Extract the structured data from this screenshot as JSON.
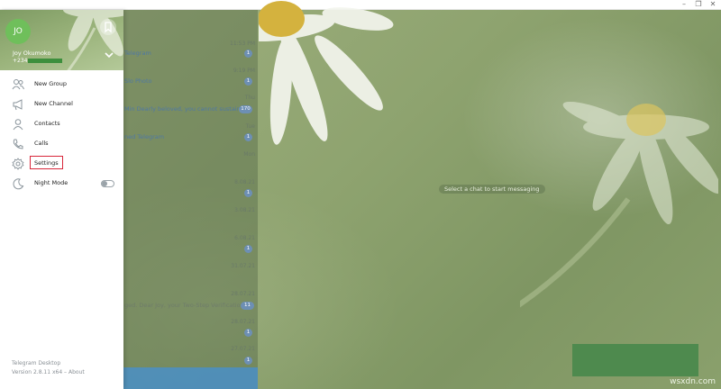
{
  "window": {
    "controls": [
      "–",
      "❐",
      "✕"
    ]
  },
  "main": {
    "empty_state": "Select a chat to start messaging"
  },
  "watermark": "wsxdn.com",
  "account": {
    "avatar_initials": "JO",
    "name": "Joy Okumoko",
    "phone_prefix": "+234"
  },
  "menu": {
    "items": [
      {
        "label": "New Group",
        "icon": "new-group-icon"
      },
      {
        "label": "New Channel",
        "icon": "megaphone-icon"
      },
      {
        "label": "Contacts",
        "icon": "contact-icon"
      },
      {
        "label": "Calls",
        "icon": "phone-icon"
      },
      {
        "label": "Settings",
        "icon": "gear-icon"
      },
      {
        "label": "Night Mode",
        "icon": "moon-icon",
        "toggle": false
      }
    ],
    "footer": {
      "app_name": "Telegram Desktop",
      "version": "Version 2.8.11 x64 – About"
    }
  },
  "chats": [
    {
      "time": "11:53 PM",
      "text": "Telegram",
      "badge": "1"
    },
    {
      "time": "9:19 PM",
      "text": "Slo Photo",
      "badge": "1"
    },
    {
      "time": "Thu",
      "text": "Min Dearly beloved, you cannot sustain...",
      "badge": "170"
    },
    {
      "time": "Tue",
      "text": "ned Telegram",
      "badge": "1"
    },
    {
      "time": "Mon",
      "text": "",
      "badge": ""
    },
    {
      "time": "8.08.21",
      "text": "",
      "badge": "1"
    },
    {
      "time": "3.08.21",
      "text": "",
      "badge": ""
    },
    {
      "time": "6.08.21",
      "text": "",
      "badge": "1"
    },
    {
      "time": "31.07.21",
      "text": "",
      "badge": ""
    },
    {
      "time": "28.07.21",
      "text": "ged. Dear Joy, your Two-Step Verification...",
      "badge": "11"
    },
    {
      "time": "28.07.21",
      "text": "",
      "badge": "1"
    },
    {
      "time": "27.07.21",
      "text": "",
      "badge": "1"
    }
  ],
  "colors": {
    "accent": "#4a8fc7",
    "avatar": "#6fbf5b",
    "highlight": "#d8263a"
  }
}
